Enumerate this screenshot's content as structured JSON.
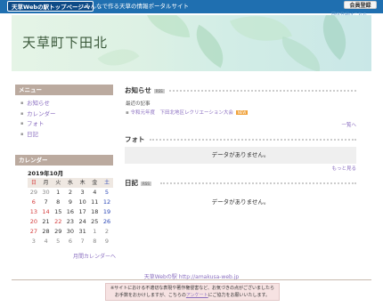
{
  "topbar": {
    "logo": "天草Webの駅トップページへ",
    "slogan": "みんなで作る天草の情報ポータルサイト",
    "member_button": "会員登録",
    "member_sub": "団体登録はこちら"
  },
  "header": {
    "title": "天草町下田北"
  },
  "sidebar": {
    "menu_heading": "メニュー",
    "menu_items": [
      "お知らせ",
      "カレンダー",
      "フォト",
      "日記"
    ],
    "calendar_heading": "カレンダー",
    "calendar_month": "2019年10月",
    "weekdays": [
      "日",
      "月",
      "火",
      "水",
      "木",
      "金",
      "土"
    ],
    "weeks": [
      [
        "29",
        "30",
        "1",
        "2",
        "3",
        "4",
        "5"
      ],
      [
        "6",
        "7",
        "8",
        "9",
        "10",
        "11",
        "12"
      ],
      [
        "13",
        "14",
        "15",
        "16",
        "17",
        "18",
        "19"
      ],
      [
        "20",
        "21",
        "22",
        "23",
        "24",
        "25",
        "26"
      ],
      [
        "27",
        "28",
        "29",
        "30",
        "31",
        "1",
        "2"
      ],
      [
        "3",
        "4",
        "5",
        "6",
        "7",
        "8",
        "9"
      ]
    ],
    "calendar_link": "月間カレンダーへ"
  },
  "news": {
    "title": "お知らせ",
    "badge": "RSS",
    "subheading": "最近の記事",
    "item": "令和元年度　下田北地区レクリエーション大会",
    "item_badge": "NEW",
    "more": "一覧へ"
  },
  "photo": {
    "title": "フォト",
    "empty": "データがありません。",
    "more": "もっと見る"
  },
  "diary": {
    "title": "日記",
    "badge": "RSS",
    "empty": "データがありません。"
  },
  "footer": {
    "link": "天草Webの駅 http://amakusa-web.jp",
    "notice_line1": "※サイトにおける不適切な表現や著作権侵害など、お気づきの点がございましたら",
    "notice_line2_pre": "お手数をおかけしますが、こちらの",
    "notice_link": "アンケート",
    "notice_line2_post": "にご協力をお願いいたします。"
  }
}
